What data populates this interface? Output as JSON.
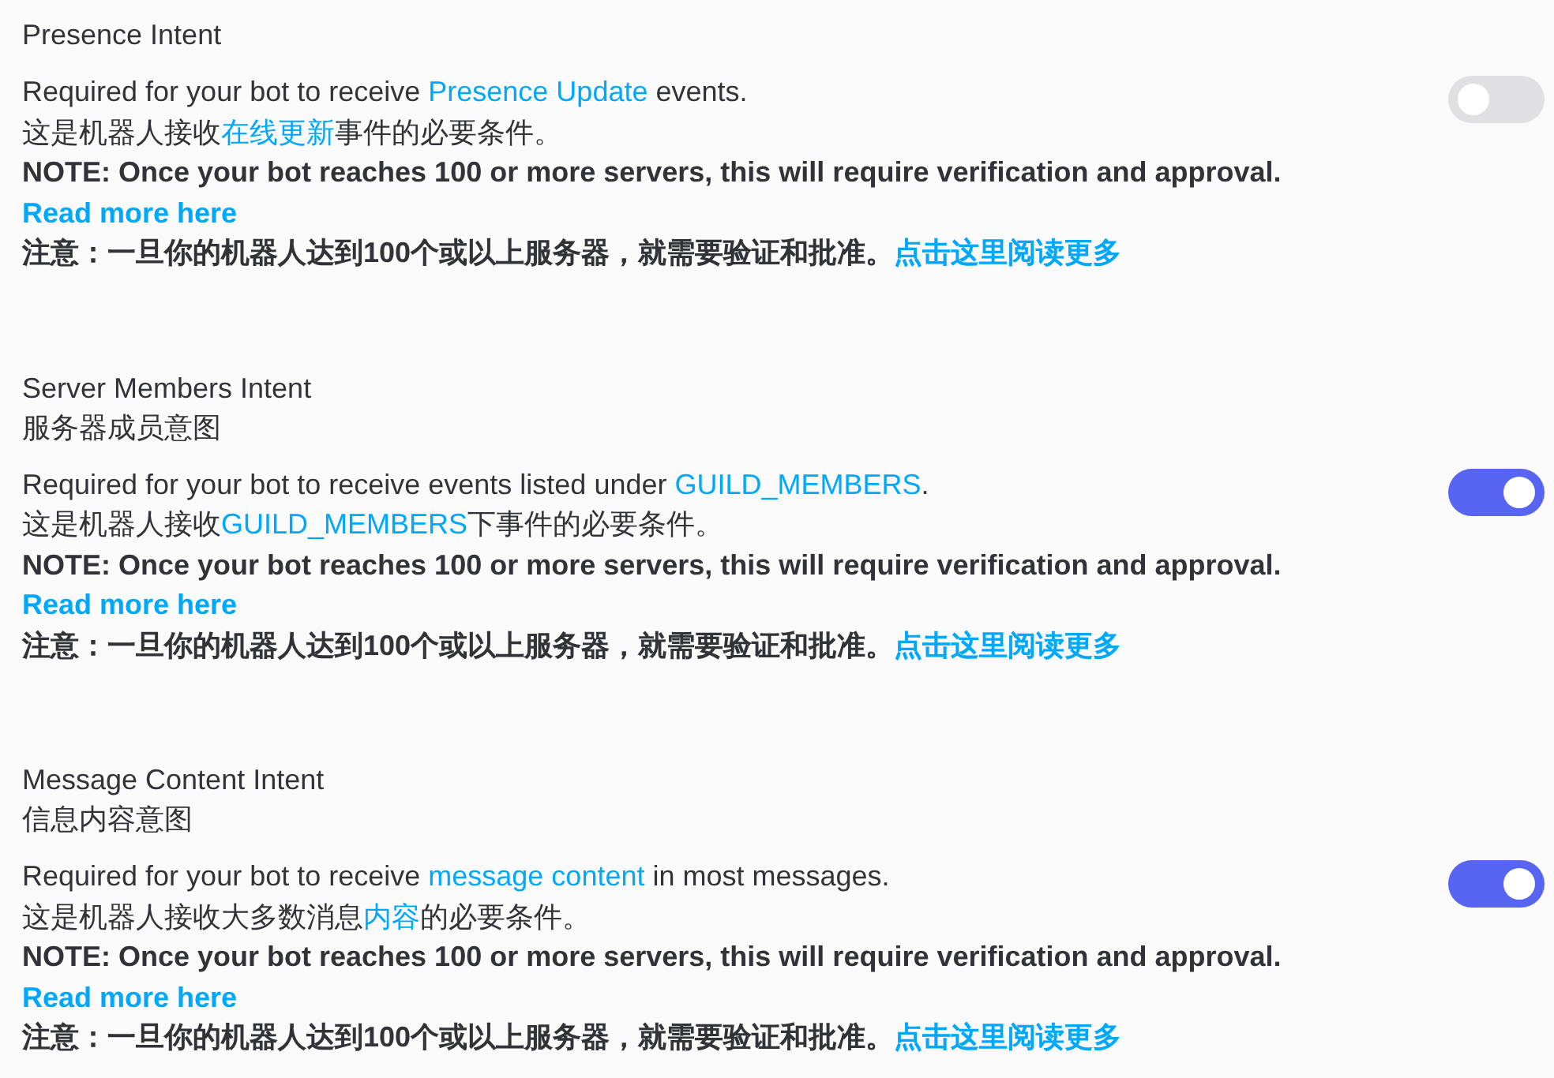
{
  "intents": [
    {
      "title": "Presence Intent",
      "enabled": false,
      "lines": [
        [
          {
            "kind": "text",
            "text": "Required for your bot to receive "
          },
          {
            "kind": "link",
            "text": "Presence Update"
          },
          {
            "kind": "text",
            "text": " events."
          }
        ],
        [
          {
            "kind": "text",
            "text": "这是机器人接收"
          },
          {
            "kind": "link",
            "text": "在线更新"
          },
          {
            "kind": "text",
            "text": "事件的必要条件。"
          }
        ],
        [
          {
            "kind": "bold",
            "text": "NOTE: Once your bot reaches 100 or more servers, this will require verification and approval."
          }
        ],
        [
          {
            "kind": "boldlink",
            "text": "Read more here"
          }
        ],
        [
          {
            "kind": "bold",
            "text": "注意：一旦你的机器人达到100个或以上服务器，就需要验证和批准。"
          },
          {
            "kind": "boldlink",
            "text": "点击这里阅读更多"
          }
        ]
      ]
    },
    {
      "title": "Server Members Intent",
      "subtitle": "服务器成员意图",
      "enabled": true,
      "lines": [
        [
          {
            "kind": "text",
            "text": "Required for your bot to receive events listed under "
          },
          {
            "kind": "link",
            "text": "GUILD_MEMBERS"
          },
          {
            "kind": "text",
            "text": "."
          }
        ],
        [
          {
            "kind": "text",
            "text": "这是机器人接收"
          },
          {
            "kind": "link",
            "text": "GUILD_MEMBERS"
          },
          {
            "kind": "text",
            "text": "下事件的必要条件。"
          }
        ],
        [
          {
            "kind": "bold",
            "text": "NOTE: Once your bot reaches 100 or more servers, this will require verification and approval."
          }
        ],
        [
          {
            "kind": "boldlink",
            "text": "Read more here"
          }
        ],
        [
          {
            "kind": "bold",
            "text": "注意：一旦你的机器人达到100个或以上服务器，就需要验证和批准。"
          },
          {
            "kind": "boldlink",
            "text": "点击这里阅读更多"
          }
        ]
      ]
    },
    {
      "title": "Message Content Intent",
      "subtitle": "信息内容意图",
      "enabled": true,
      "lines": [
        [
          {
            "kind": "text",
            "text": "Required for your bot to receive "
          },
          {
            "kind": "link",
            "text": "message content"
          },
          {
            "kind": "text",
            "text": " in most messages."
          }
        ],
        [
          {
            "kind": "text",
            "text": "这是机器人接收大多数消息"
          },
          {
            "kind": "link",
            "text": "内容"
          },
          {
            "kind": "text",
            "text": "的必要条件。"
          }
        ],
        [
          {
            "kind": "bold",
            "text": "NOTE: Once your bot reaches 100 or more servers, this will require verification and approval."
          }
        ],
        [
          {
            "kind": "boldlink",
            "text": "Read more here"
          }
        ],
        [
          {
            "kind": "bold",
            "text": "注意：一旦你的机器人达到100个或以上服务器，就需要验证和批准。"
          },
          {
            "kind": "boldlink",
            "text": "点击这里阅读更多"
          }
        ]
      ]
    }
  ]
}
